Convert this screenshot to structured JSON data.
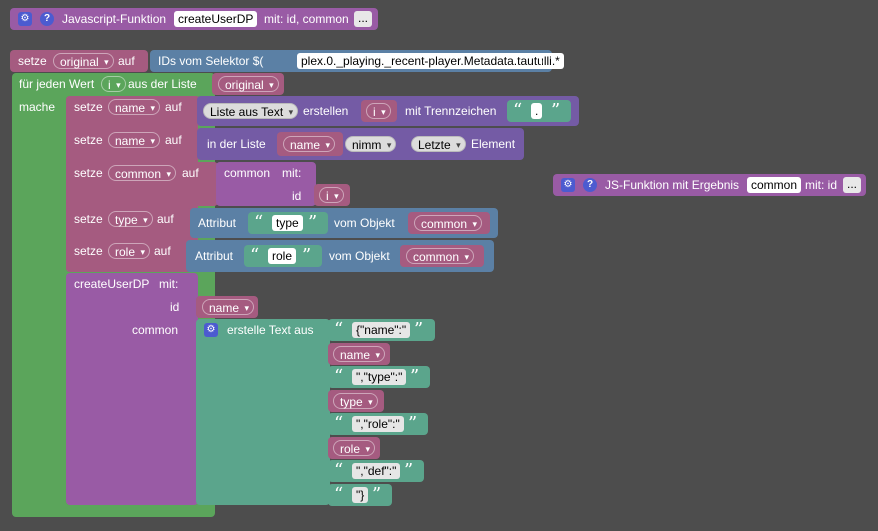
{
  "func_def": {
    "prefix": "Javascript-Funktion",
    "name": "createUserDP",
    "suffix": "mit: id, common",
    "more": "..."
  },
  "js_func_result": {
    "label": "JS-Funktion mit Ergebnis",
    "name": "common",
    "suffix": "mit: id",
    "more": "..."
  },
  "set_original": {
    "setze": "setze",
    "var": "original",
    "auf": "auf",
    "selector_label": "IDs vom Selektor $(",
    "selector_value": "plex.0._playing._recent-player.Metadata.tautulli.*",
    "selector_close": ")"
  },
  "for_each": {
    "label": "für jeden Wert",
    "var": "i",
    "from_list": "aus der Liste",
    "list": "original",
    "do": "mache"
  },
  "set_name1": {
    "setze": "setze",
    "var": "name",
    "auf": "auf",
    "op": "Liste aus Text",
    "create": "erstellen",
    "source": "i",
    "delim_label": "mit Trennzeichen",
    "delim": "."
  },
  "set_name2": {
    "setze": "setze",
    "var": "name",
    "auf": "auf",
    "in_list": "in der Liste",
    "list": "name",
    "take": "nimm",
    "which": "Letzte",
    "elem": "Element"
  },
  "set_common": {
    "setze": "setze",
    "var": "common",
    "auf": "auf",
    "func": "common",
    "with": "mit:",
    "arg_label": "id",
    "arg": "i"
  },
  "set_type": {
    "setze": "setze",
    "var": "type",
    "auf": "auf",
    "attr": "Attribut",
    "key": "type",
    "of_obj": "vom Objekt",
    "obj": "common"
  },
  "set_role": {
    "setze": "setze",
    "var": "role",
    "auf": "auf",
    "attr": "Attribut",
    "key": "role",
    "of_obj": "vom Objekt",
    "obj": "common"
  },
  "call": {
    "label": "createUserDP",
    "with": "mit:",
    "id_label": "id",
    "id_var": "name",
    "common_label": "common",
    "join_label": "erstelle Text aus"
  },
  "join_items": [
    {
      "kind": "text",
      "value": "{\"name\":\""
    },
    {
      "kind": "var",
      "value": "name"
    },
    {
      "kind": "text",
      "value": "\",\"type\":\""
    },
    {
      "kind": "var",
      "value": "type"
    },
    {
      "kind": "text",
      "value": "\",\"role\":\""
    },
    {
      "kind": "var",
      "value": "role"
    },
    {
      "kind": "text",
      "value": "\",\"def\":\""
    },
    {
      "kind": "text",
      "value": "\"}"
    }
  ],
  "colors": {
    "background": "#4d4d4d",
    "variables": "#a55b80",
    "procedures": "#995ba5",
    "text": "#5ba58c",
    "loops": "#5ba55b",
    "io": "#5b80a5"
  },
  "icons": [
    "gear-icon",
    "help-icon",
    "dropdown-arrow-icon",
    "quote-open-icon",
    "quote-close-icon"
  ]
}
